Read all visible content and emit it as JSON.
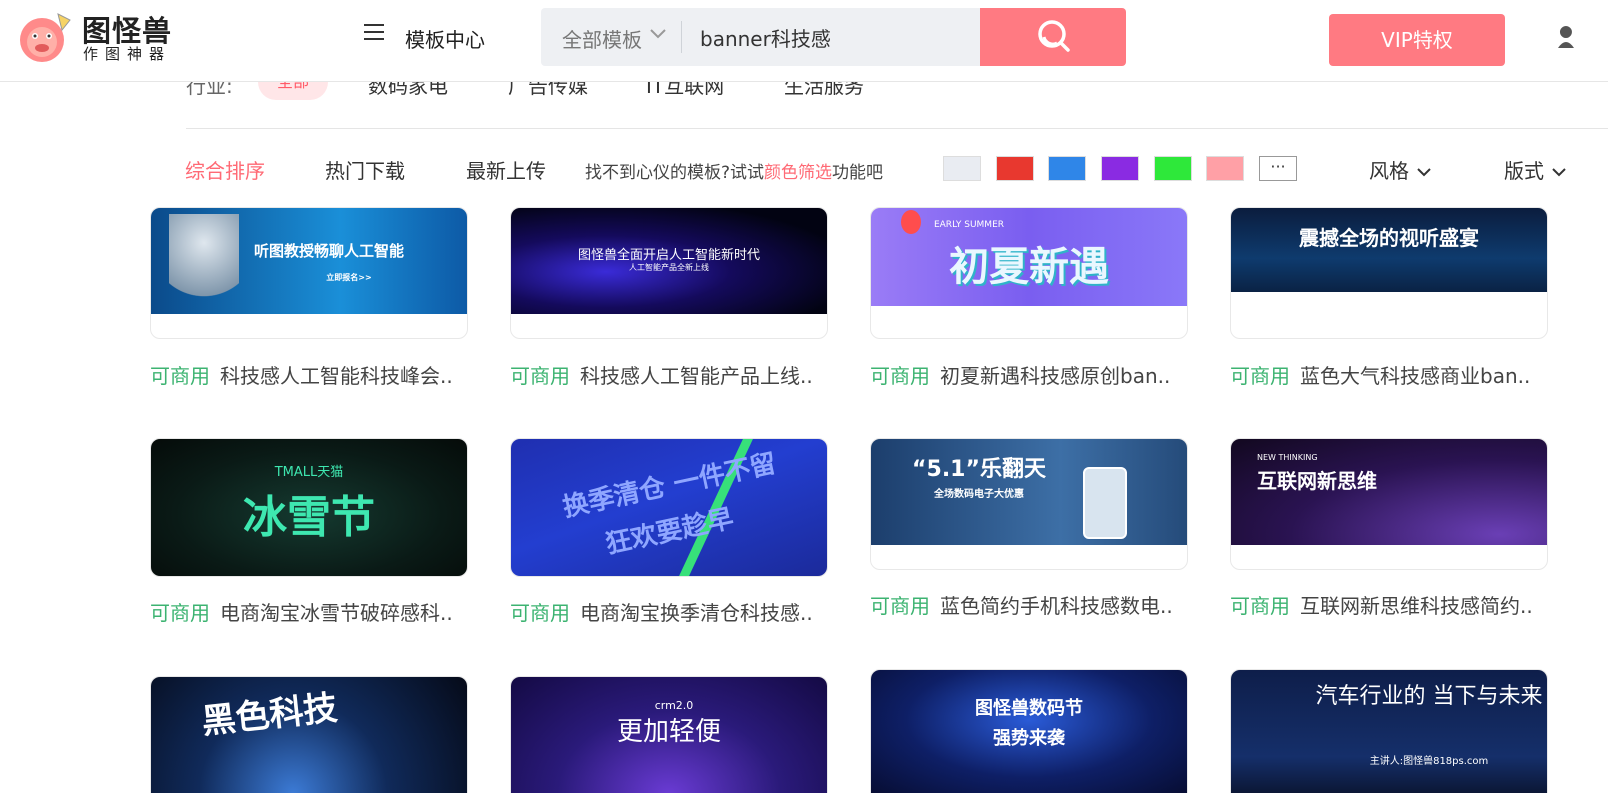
{
  "brand": {
    "name": "图怪兽",
    "sub": "作图神器"
  },
  "nav": {
    "template_center": "模板中心"
  },
  "search": {
    "category": "全部模板",
    "query": "banner科技感"
  },
  "vip": {
    "label": "VIP特权"
  },
  "colors": {
    "accent": "#ff7a82",
    "free_green": "#3cb371",
    "sort_active": "#ff6a75"
  },
  "industry": {
    "label": "行业:",
    "items": [
      "全部",
      "数码家电",
      "广告传媒",
      "IT互联网",
      "生活服务"
    ]
  },
  "sort": {
    "items": [
      "综合排序",
      "热门下载",
      "最新上传"
    ]
  },
  "tip": {
    "before": "找不到心仪的模板?试试",
    "link": "颜色筛选",
    "after": "功能吧"
  },
  "swatches": [
    "#e9ecf2",
    "#e8382f",
    "#2f86e8",
    "#8a2be2",
    "#2ee83a",
    "#ffa0a6"
  ],
  "more_label": "···",
  "filters": {
    "style": "风格",
    "layout": "版式"
  },
  "free_label": "可商用",
  "cards": [
    {
      "title": "科技感人工智能科技峰会..",
      "thumb_line1": "听图教授畅聊人工智能",
      "thumb_line2": "立即报名>>"
    },
    {
      "title": "科技感人工智能产品上线..",
      "thumb_line1": "图怪兽全面开启人工智能新时代",
      "thumb_line2": "人工智能产品全新上线"
    },
    {
      "title": "初夏新遇科技感原创ban..",
      "thumb_line1": "初夏新遇",
      "thumb_line2": "EARLY SUMMER"
    },
    {
      "title": "蓝色大气科技感商业ban..",
      "thumb_line1": "震撼全场的视听盛宴",
      "thumb_line2": ""
    },
    {
      "title": "电商淘宝冰雪节破碎感科..",
      "thumb_line1": "冰雪节",
      "thumb_line2": "TMALL天猫"
    },
    {
      "title": "电商淘宝换季清仓科技感..",
      "thumb_line1": "换季清仓 一件不留",
      "thumb_line2": "狂欢要趁早"
    },
    {
      "title": "蓝色简约手机科技感数电..",
      "thumb_line1": "“5.1”乐翻天",
      "thumb_line2": "全场数码电子大优惠"
    },
    {
      "title": "互联网新思维科技感简约..",
      "thumb_line1": "互联网新思维",
      "thumb_line2": "NEW THINKING"
    },
    {
      "title": "",
      "thumb_line1": "黑色科技",
      "thumb_line2": ""
    },
    {
      "title": "",
      "thumb_line1": "更加轻便",
      "thumb_line2": "crm2.0"
    },
    {
      "title": "",
      "thumb_line1": "图怪兽数码节",
      "thumb_line2": "强势来袭"
    },
    {
      "title": "",
      "thumb_line1": "汽车行业的 当下与未来",
      "thumb_line2": "主讲人:图怪兽818ps.com"
    }
  ]
}
